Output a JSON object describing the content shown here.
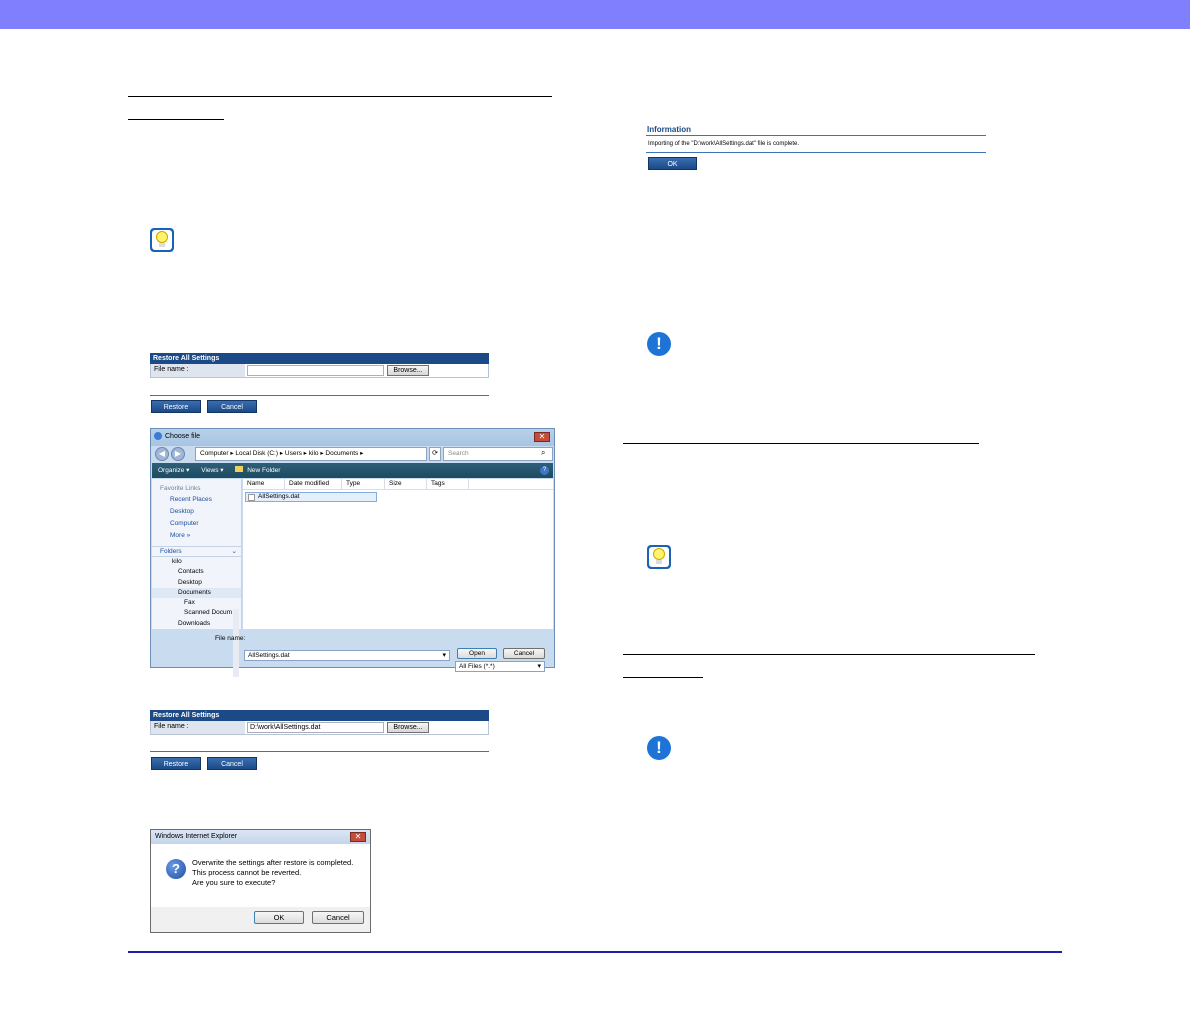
{
  "restore_panel_1": {
    "heading": "Restore All Settings",
    "file_name_label": "File name :",
    "file_name_value": "",
    "browse_label": "Browse...",
    "restore_label": "Restore",
    "cancel_label": "Cancel"
  },
  "choose_file_dialog": {
    "title": "Choose file",
    "address": "Computer ▸ Local Disk (C:) ▸ Users ▸ kilo ▸ Documents ▸",
    "search_placeholder": "Search",
    "toolbar_organize": "Organize ▾",
    "toolbar_views": "Views ▾",
    "toolbar_new_folder": "New Folder",
    "favorite_links_heading": "Favorite Links",
    "favorite_links": [
      "Recent Places",
      "Desktop",
      "Computer"
    ],
    "more_label": "More »",
    "folders_heading": "Folders",
    "folder_tree": [
      "kilo",
      "Contacts",
      "Desktop",
      "Documents",
      "Fax",
      "Scanned Docum",
      "Downloads"
    ],
    "columns": [
      "Name",
      "Date modified",
      "Type",
      "Size",
      "Tags"
    ],
    "files": [
      "AllSettings.dat"
    ],
    "file_name_label": "File name:",
    "file_name_value": "AllSettings.dat",
    "file_type_value": "All Files (*.*)",
    "open_label": "Open",
    "cancel_label": "Cancel"
  },
  "restore_panel_2": {
    "heading": "Restore All Settings",
    "file_name_label": "File name :",
    "file_name_value": "D:\\work\\AllSettings.dat",
    "browse_label": "Browse...",
    "restore_label": "Restore",
    "cancel_label": "Cancel"
  },
  "ie_dialog": {
    "title": "Windows Internet Explorer",
    "message_lines": [
      "Overwrite the settings after restore is completed.",
      "This process cannot be reverted.",
      "Are you sure to execute?"
    ],
    "ok_label": "OK",
    "cancel_label": "Cancel"
  },
  "info_panel": {
    "heading": "Information",
    "message": "Importing of the \"D:\\work\\AllSettings.dat\" file is complete.",
    "ok_label": "OK"
  },
  "icons": {
    "hint": "lightbulb-hint-icon",
    "caution": "exclamation-caution-icon",
    "question": "question-icon"
  },
  "colors": {
    "top_bar": "#8080ff",
    "bottom_rule": "#1f1fa8",
    "panel_blue": "#1b4a86"
  }
}
